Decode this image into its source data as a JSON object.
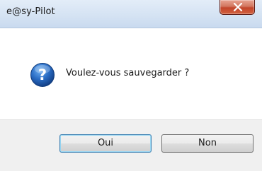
{
  "window": {
    "title": "e@sy-Pilot"
  },
  "dialog": {
    "icon": "question-icon",
    "message": "Voulez-vous sauvegarder ?"
  },
  "buttons": {
    "yes_label": "Oui",
    "no_label": "Non"
  },
  "colors": {
    "titlebar": "#d5e3f3",
    "close_button": "#c2452b",
    "icon_blue": "#1f5fb5",
    "footer": "#f0f0f0",
    "default_button_border": "#3c7fb1"
  }
}
